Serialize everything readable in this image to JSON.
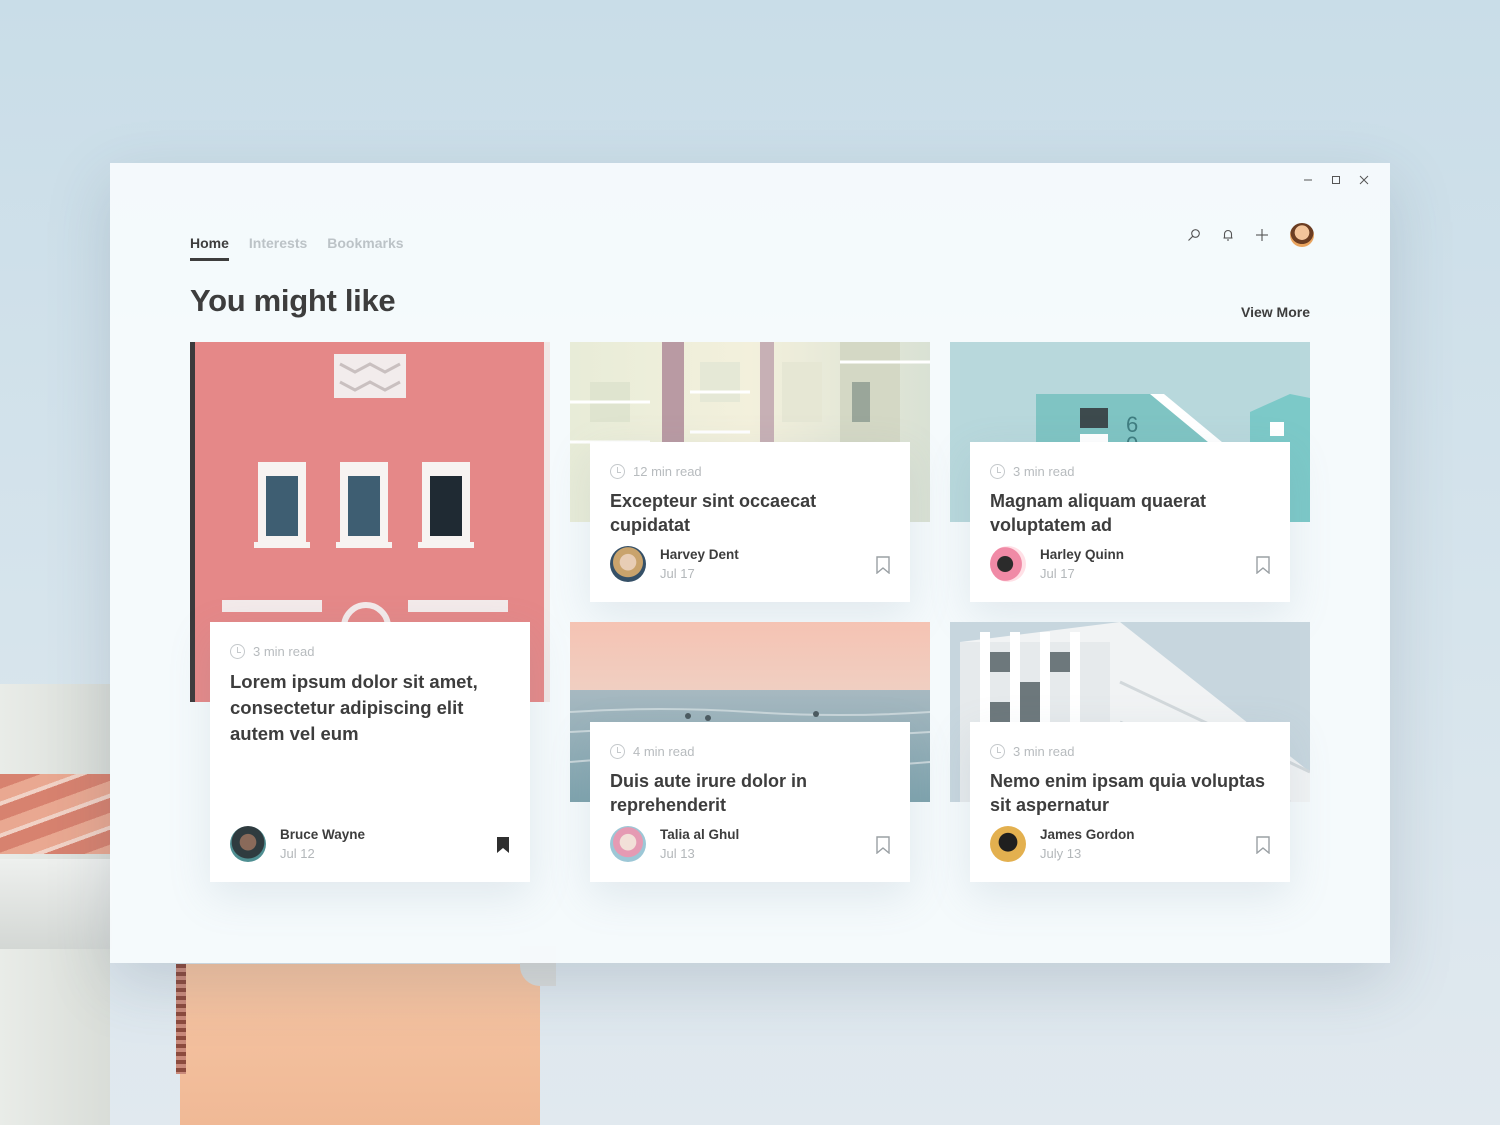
{
  "window": {
    "controls": [
      "minimize",
      "maximize",
      "close"
    ]
  },
  "nav": {
    "tabs": [
      {
        "label": "Home",
        "active": true
      },
      {
        "label": "Interests",
        "active": false
      },
      {
        "label": "Bookmarks",
        "active": false
      }
    ]
  },
  "toolbar": {
    "icons": [
      "search-icon",
      "bell-icon",
      "plus-icon",
      "user-avatar"
    ]
  },
  "main": {
    "heading": "You might like",
    "view_more": "View More"
  },
  "cards": [
    {
      "read_time": "3 min read",
      "title": "Lorem ipsum dolor sit amet, consectetur adipiscing elit autem vel eum",
      "author": "Bruce Wayne",
      "date": "Jul 12",
      "bookmarked": true
    },
    {
      "read_time": "12 min read",
      "title": "Excepteur sint occaecat cupidatat",
      "author": "Harvey Dent",
      "date": "Jul 17",
      "bookmarked": false
    },
    {
      "read_time": "3 min read",
      "title": "Magnam aliquam quaerat voluptatem ad",
      "author": "Harley Quinn",
      "date": "Jul 17",
      "bookmarked": false
    },
    {
      "read_time": "4 min read",
      "title": "Duis aute irure dolor in reprehenderit",
      "author": "Talia al Ghul",
      "date": "Jul 13",
      "bookmarked": false
    },
    {
      "read_time": "3 min read",
      "title": "Nemo enim ipsam quia voluptas sit aspernatur",
      "author": "James Gordon",
      "date": "July 13",
      "bookmarked": false
    }
  ],
  "colors": {
    "text": "#3d3d3d",
    "muted": "#b7bbbe",
    "accent_pink": "#e6878a"
  }
}
